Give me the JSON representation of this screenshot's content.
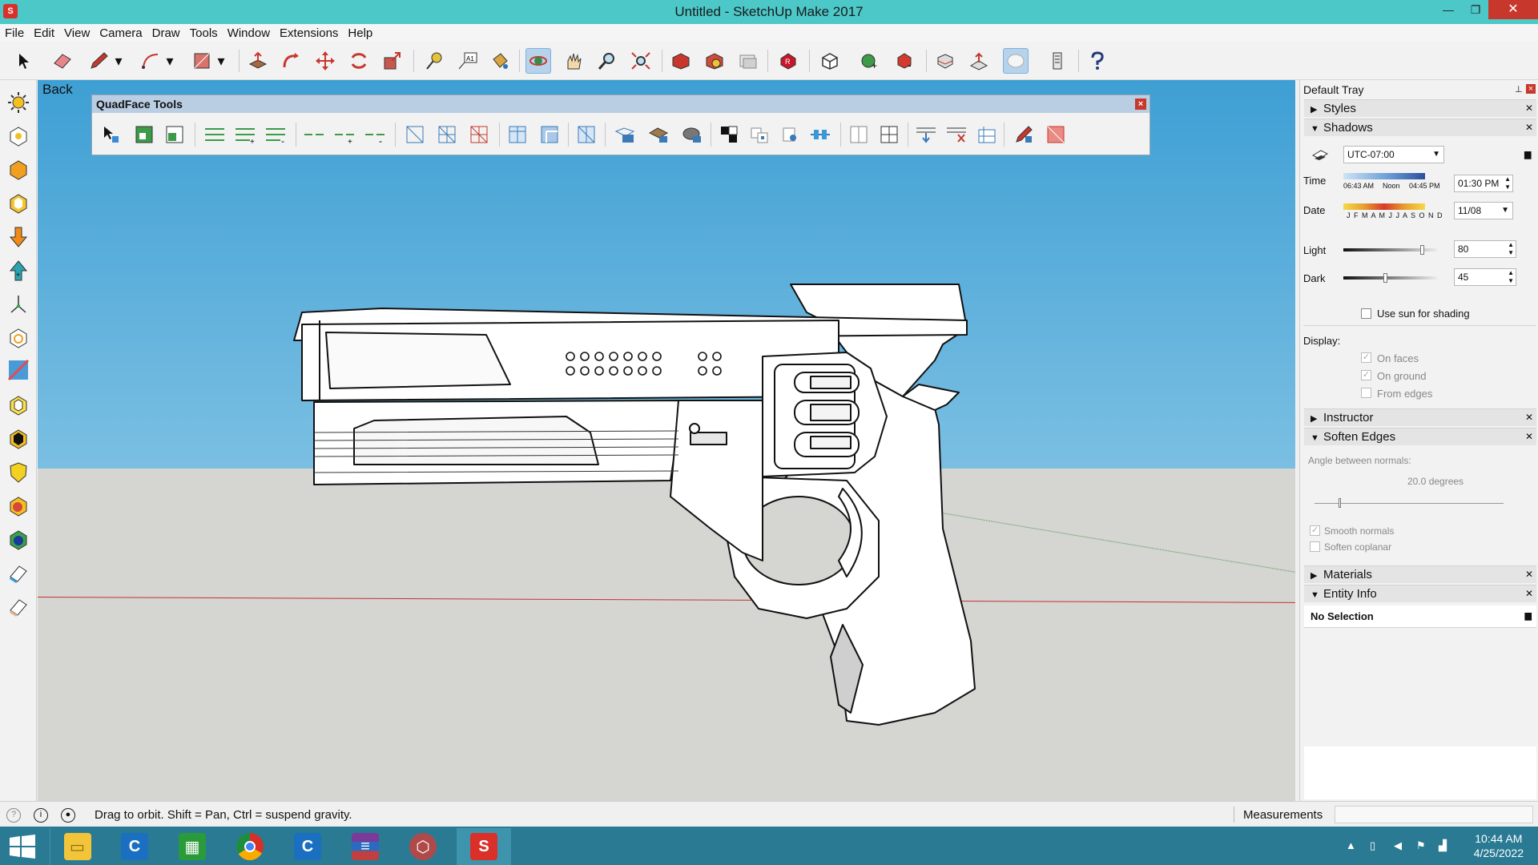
{
  "window": {
    "title": "Untitled - SketchUp Make 2017",
    "minimize": "—",
    "maximize": "❐",
    "close": "✕"
  },
  "menu": [
    "File",
    "Edit",
    "View",
    "Camera",
    "Draw",
    "Tools",
    "Window",
    "Extensions",
    "Help"
  ],
  "toolbar_icons": [
    "select-icon",
    "eraser-icon",
    "pencil-icon",
    "arc-icon",
    "rectangle-icon",
    "push-pull-icon",
    "follow-me-icon",
    "move-icon",
    "rotate-icon",
    "scale-icon",
    "tape-measure-icon",
    "text-icon",
    "paint-bucket-icon",
    "orbit-icon",
    "pan-icon",
    "zoom-icon",
    "zoom-extents-icon",
    "3d-warehouse-icon",
    "extension-warehouse-icon",
    "layout-icon",
    "extension-manager-icon",
    "component-icon",
    "solid-union-icon",
    "solid-subtract-icon",
    "section-plane-icon",
    "add-location-icon",
    "shadows-icon",
    "texture-icon",
    "help-icon"
  ],
  "viewport": {
    "scene_label": "Back"
  },
  "quadface": {
    "title": "QuadFace Tools",
    "close": "×"
  },
  "tray": {
    "title": "Default Tray",
    "styles": "Styles",
    "shadows": {
      "header": "Shadows",
      "timezone": "UTC-07:00",
      "time_label": "Time",
      "time_start": "06:43 AM",
      "time_noon": "Noon",
      "time_end": "04:45 PM",
      "time_value": "01:30 PM",
      "date_label": "Date",
      "months": "J F M A M J J A S O N D",
      "date_value": "11/08",
      "light_label": "Light",
      "light_value": "80",
      "dark_label": "Dark",
      "dark_value": "45",
      "use_sun": "Use sun for shading",
      "display_label": "Display:",
      "on_faces": "On faces",
      "on_ground": "On ground",
      "from_edges": "From edges"
    },
    "instructor": "Instructor",
    "soften_edges": {
      "header": "Soften Edges",
      "angle_label": "Angle between normals:",
      "angle_value": "20.0  degrees",
      "smooth_normals": "Smooth normals",
      "soften_coplanar": "Soften coplanar"
    },
    "materials": "Materials",
    "entity_info": {
      "header": "Entity Info",
      "selection": "No Selection"
    }
  },
  "status": {
    "text": "Drag to orbit. Shift = Pan, Ctrl = suspend gravity.",
    "measurements": "Measurements"
  },
  "taskbar": {
    "apps": [
      "file-explorer",
      "ccleaner",
      "calculator",
      "chrome",
      "ccleaner",
      "winrar",
      "sketchup-generic",
      "sketchup"
    ],
    "time": "10:44 AM",
    "date": "4/25/2022"
  }
}
